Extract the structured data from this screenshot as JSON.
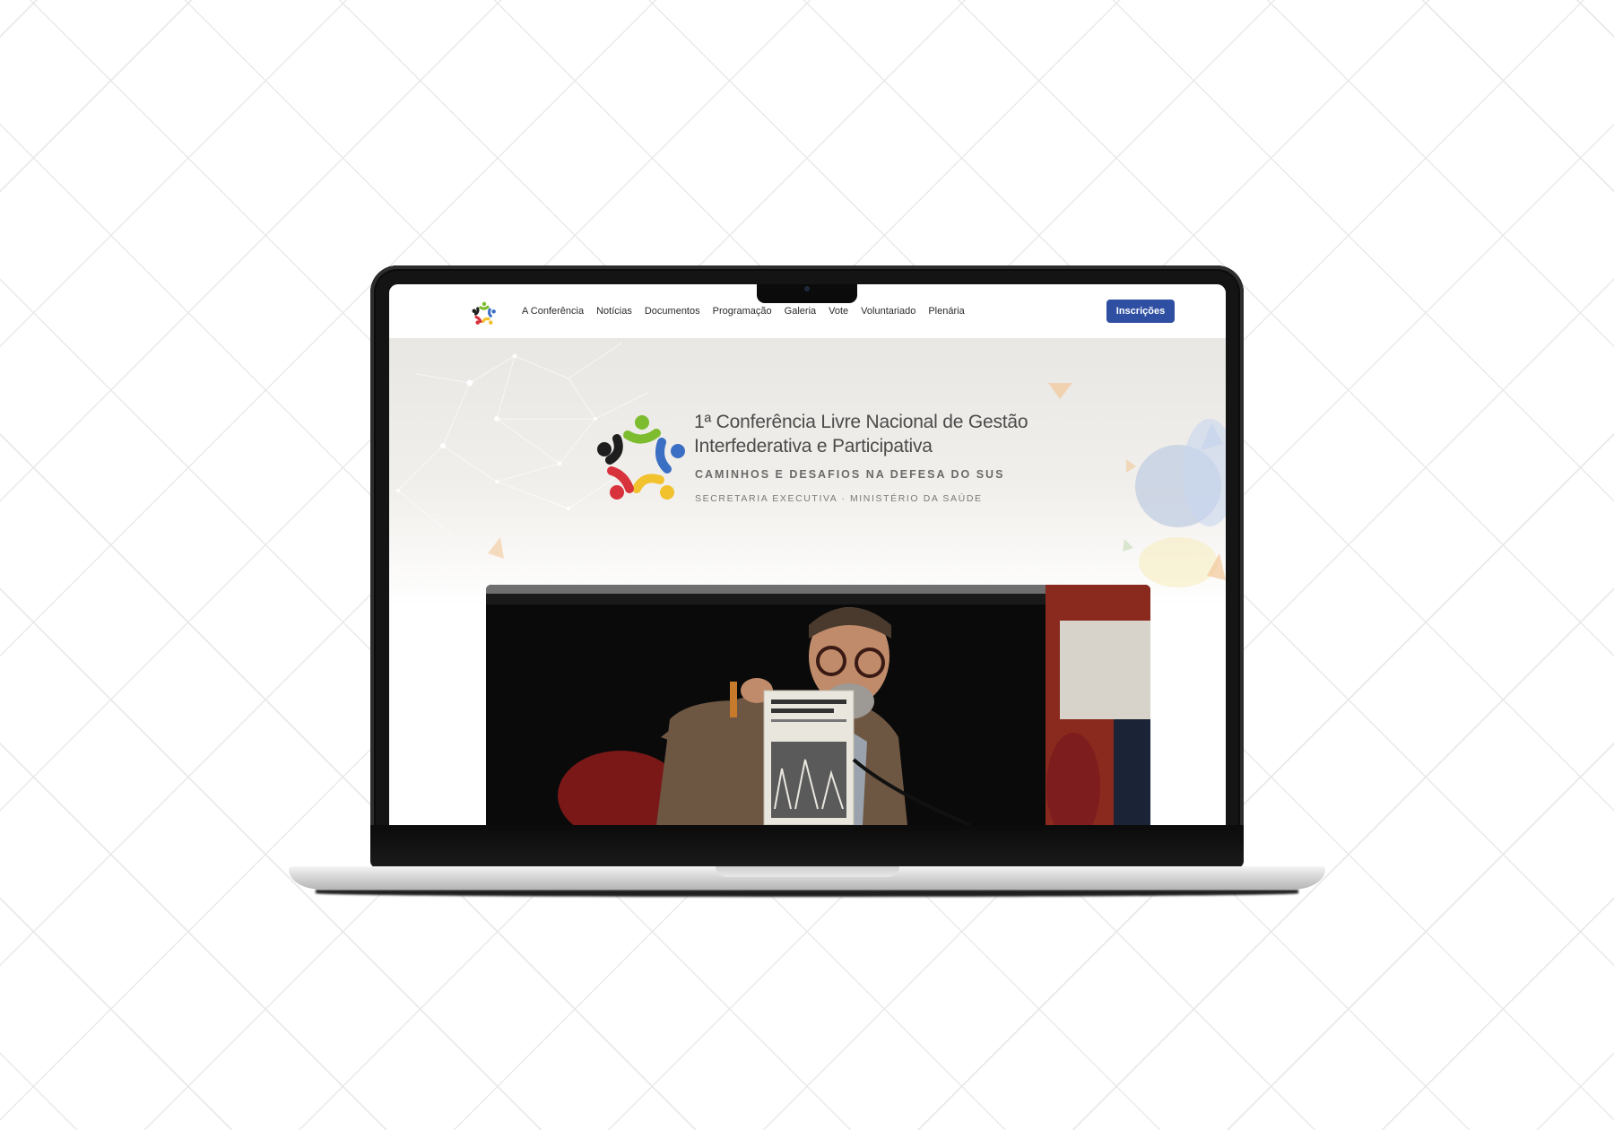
{
  "nav": {
    "links": [
      "A Conferência",
      "Notícias",
      "Documentos",
      "Programação",
      "Galeria",
      "Vote",
      "Voluntariado",
      "Plenária"
    ],
    "cta_label": "Inscrições"
  },
  "hero": {
    "title_line1": "1ª Conferência Livre Nacional de Gestão",
    "title_line2": "Interfederativa e Participativa",
    "subtitle": "CAMINHOS E DESAFIOS NA DEFESA DO SUS",
    "organization": "SECRETARIA EXECUTIVA · MINISTÉRIO DA SAÚDE"
  },
  "colors": {
    "accent": "#2f4fa3",
    "logo_green": "#7dbb2f",
    "logo_blue": "#3b6fc4",
    "logo_yellow": "#f2c12e",
    "logo_red": "#d8323c",
    "logo_black": "#1e1e1e"
  },
  "photo": {
    "description_icon": "speaker-photo"
  }
}
